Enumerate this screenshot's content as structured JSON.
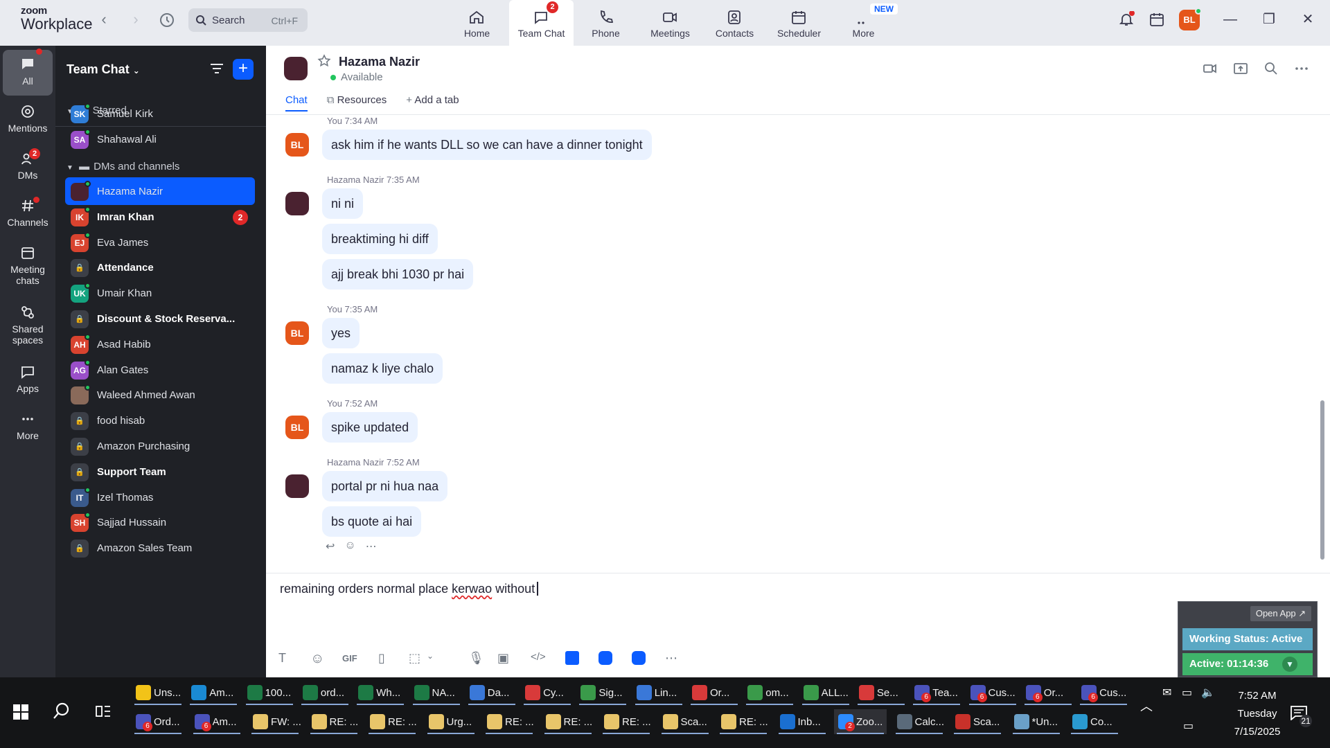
{
  "app": {
    "logo_line1": "zoom",
    "logo_line2": "Workplace",
    "search_placeholder": "Search",
    "search_shortcut": "Ctrl+F",
    "tabs": [
      {
        "label": "Home",
        "icon": "home-icon"
      },
      {
        "label": "Team Chat",
        "icon": "chat-icon",
        "badge": "2",
        "active": true
      },
      {
        "label": "Phone",
        "icon": "phone-icon"
      },
      {
        "label": "Meetings",
        "icon": "video-icon"
      },
      {
        "label": "Contacts",
        "icon": "contacts-icon"
      },
      {
        "label": "Scheduler",
        "icon": "calendar-icon"
      },
      {
        "label": "More",
        "icon": "more-icon",
        "new_label": "NEW"
      }
    ],
    "user_initials": "BL",
    "accent": "#0b5cff"
  },
  "rail": [
    {
      "label": "All",
      "icon": "chat-bubble-icon",
      "active": true
    },
    {
      "label": "Mentions",
      "icon": "at-icon"
    },
    {
      "label": "DMs",
      "icon": "people-icon",
      "badge": "2"
    },
    {
      "label": "Channels",
      "icon": "hash-icon"
    },
    {
      "label": "Meeting chats",
      "icon": "calendar-icon"
    },
    {
      "label": "Shared spaces",
      "icon": "shared-icon"
    },
    {
      "label": "Apps",
      "icon": "apps-icon"
    },
    {
      "label": "More",
      "icon": "ellipsis-icon"
    }
  ],
  "sidebar": {
    "title": "Team Chat",
    "starred_label": "Starred",
    "dms_label": "DMs and channels",
    "starred": [
      {
        "initials": "SK",
        "name": "Samuel Kirk",
        "color": "#2f7dd6"
      },
      {
        "initials": "SA",
        "name": "Shahawal Ali",
        "color": "#9a4fc9"
      }
    ],
    "contacts": [
      {
        "initials": "",
        "name": "Hazama Nazir",
        "color": "#4a2230",
        "active": true
      },
      {
        "initials": "IK",
        "name": "Imran Khan",
        "color": "#d8432f",
        "bold": true,
        "badge": "2"
      },
      {
        "initials": "EJ",
        "name": "Eva James",
        "color": "#d8432f"
      },
      {
        "initials": "",
        "name": "Attendance",
        "lock": true,
        "bold": true
      },
      {
        "initials": "UK",
        "name": "Umair Khan",
        "color": "#14a37f"
      },
      {
        "initials": "",
        "name": "Discount & Stock Reserva...",
        "lock": true,
        "bold": true
      },
      {
        "initials": "AH",
        "name": "Asad Habib",
        "color": "#d8432f"
      },
      {
        "initials": "AG",
        "name": "Alan Gates",
        "color": "#9a4fc9"
      },
      {
        "initials": "",
        "name": "Waleed Ahmed Awan",
        "color": "#8a6a5a"
      },
      {
        "initials": "",
        "name": "food hisab",
        "lock": true
      },
      {
        "initials": "",
        "name": "Amazon Purchasing",
        "lock": true
      },
      {
        "initials": "",
        "name": "Support Team",
        "lock": true,
        "bold": true
      },
      {
        "initials": "IT",
        "name": "Izel Thomas",
        "color": "#3a5a8c"
      },
      {
        "initials": "SH",
        "name": "Sajjad Hussain",
        "color": "#d8432f"
      },
      {
        "initials": "",
        "name": "Amazon Sales Team",
        "lock": true
      }
    ]
  },
  "chat": {
    "name": "Hazama Nazir",
    "status": "Available",
    "tabs": [
      "Chat",
      "Resources",
      "Add a tab"
    ],
    "groups": [
      {
        "meta": "You 7:34 AM",
        "me": true,
        "messages": [
          "ask him if he wants DLL so we can have a dinner tonight"
        ]
      },
      {
        "meta": "Hazama Nazir 7:35 AM",
        "me": false,
        "messages": [
          "ni ni",
          "breaktiming hi diff",
          "ajj break bhi 1030 pr hai"
        ]
      },
      {
        "meta": "You 7:35 AM",
        "me": true,
        "messages": [
          "yes",
          "namaz k liye chalo"
        ]
      },
      {
        "meta": "You 7:52 AM",
        "me": true,
        "messages": [
          "spike updated"
        ]
      },
      {
        "meta": "Hazama Nazir 7:52 AM",
        "me": false,
        "messages": [
          "portal pr ni hua naa",
          "bs quote ai hai"
        ]
      }
    ],
    "composer_prefix": "remaining orders normal place ",
    "composer_typo": "kerwao",
    "composer_suffix": " without"
  },
  "working_status": {
    "open_app": "Open App ↗",
    "status": "Working Status: Active",
    "active": "Active: 01:14:36"
  },
  "taskbar": {
    "row1": [
      {
        "label": "Uns...",
        "color": "#f2c318"
      },
      {
        "label": "Am...",
        "color": "#1a8ad4"
      },
      {
        "label": "100...",
        "color": "#1d7a45"
      },
      {
        "label": "ord...",
        "color": "#1d7a45"
      },
      {
        "label": "Wh...",
        "color": "#1d7a45"
      },
      {
        "label": "NA...",
        "color": "#1d7a45"
      },
      {
        "label": "Da...",
        "color": "#3a78d8"
      },
      {
        "label": "Cy...",
        "color": "#d83a3a"
      },
      {
        "label": "Sig...",
        "color": "#3a9a4a"
      },
      {
        "label": "Lin...",
        "color": "#3a78d8"
      },
      {
        "label": "Or...",
        "color": "#d83a3a"
      },
      {
        "label": "om...",
        "color": "#3a9a4a"
      },
      {
        "label": "ALL...",
        "color": "#3a9a4a"
      },
      {
        "label": "Se...",
        "color": "#d83a3a"
      },
      {
        "label": "Tea...",
        "color": "#4b53bc",
        "badge": "6"
      },
      {
        "label": "Cus...",
        "color": "#4b53bc",
        "badge": "6"
      },
      {
        "label": "Or...",
        "color": "#4b53bc",
        "badge": "6"
      },
      {
        "label": "Cus...",
        "color": "#4b53bc",
        "badge": "6"
      }
    ],
    "row2": [
      {
        "label": "Ord...",
        "color": "#4b53bc",
        "badge": "6"
      },
      {
        "label": "Am...",
        "color": "#4b53bc",
        "badge": "6"
      },
      {
        "label": "FW: ...",
        "color": "#e8c56a"
      },
      {
        "label": "RE: ...",
        "color": "#e8c56a"
      },
      {
        "label": "RE: ...",
        "color": "#e8c56a"
      },
      {
        "label": "Urg...",
        "color": "#e8c56a"
      },
      {
        "label": "RE: ...",
        "color": "#e8c56a"
      },
      {
        "label": "RE: ...",
        "color": "#e8c56a"
      },
      {
        "label": "RE: ...",
        "color": "#e8c56a"
      },
      {
        "label": "Sca...",
        "color": "#e8c56a"
      },
      {
        "label": "RE: ...",
        "color": "#e8c56a"
      },
      {
        "label": "Inb...",
        "color": "#1a6fd0"
      },
      {
        "label": "Zoo...",
        "color": "#2d8cff",
        "badge": "2",
        "active": true
      },
      {
        "label": "Calc...",
        "color": "#5a6a7a"
      },
      {
        "label": "Sca...",
        "color": "#c8312a"
      },
      {
        "label": "*Un...",
        "color": "#6aa0c8"
      },
      {
        "label": "Co...",
        "color": "#2a9ad0"
      }
    ],
    "time": "7:52 AM",
    "day": "Tuesday",
    "date": "7/15/2025",
    "notification_count": "21"
  }
}
